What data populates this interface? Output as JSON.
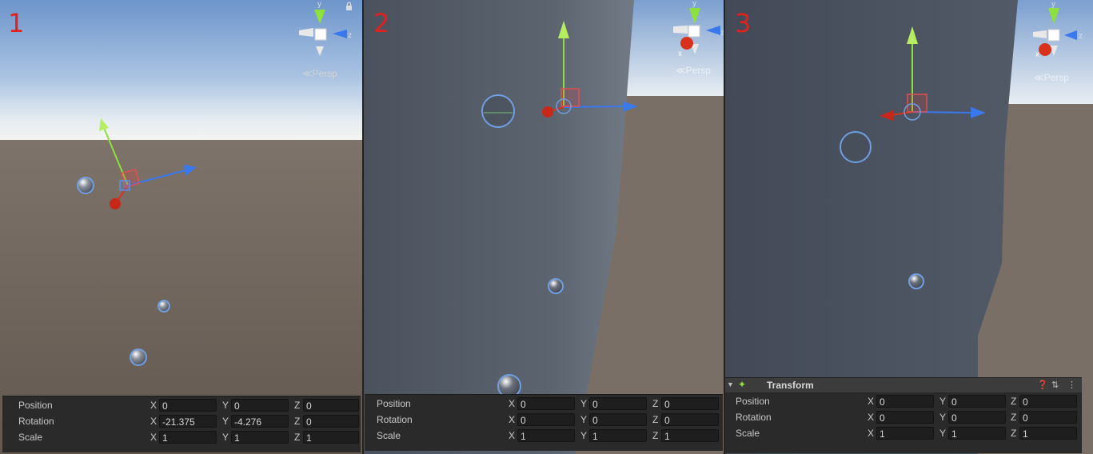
{
  "panels": [
    {
      "number": "1",
      "persp_label": "Persp",
      "gizmo": {
        "y": "y",
        "z": "z",
        "x": ""
      },
      "inspector": {
        "rows": [
          {
            "label": "Position",
            "x": "0",
            "y": "0",
            "z": "0"
          },
          {
            "label": "Rotation",
            "x": "-21.375",
            "y": "-4.276",
            "z": "0"
          },
          {
            "label": "Scale",
            "x": "1",
            "y": "1",
            "z": "1"
          }
        ]
      }
    },
    {
      "number": "2",
      "persp_label": "Persp",
      "gizmo": {
        "y": "y",
        "z": "z",
        "x": "x"
      },
      "inspector": {
        "rows": [
          {
            "label": "Position",
            "x": "0",
            "y": "0",
            "z": "0"
          },
          {
            "label": "Rotation",
            "x": "0",
            "y": "0",
            "z": "0"
          },
          {
            "label": "Scale",
            "x": "1",
            "y": "1",
            "z": "1"
          }
        ]
      }
    },
    {
      "number": "3",
      "persp_label": "Persp",
      "gizmo": {
        "y": "y",
        "z": "z",
        "x": "x"
      },
      "inspector": {
        "header": "Transform",
        "rows": [
          {
            "label": "Position",
            "x": "0",
            "y": "0",
            "z": "0"
          },
          {
            "label": "Rotation",
            "x": "0",
            "y": "0",
            "z": "0"
          },
          {
            "label": "Scale",
            "x": "1",
            "y": "1",
            "z": "1"
          }
        ]
      }
    }
  ],
  "axis_letters": {
    "x": "X",
    "y": "Y",
    "z": "Z"
  },
  "colors": {
    "axis_x": "#d8321e",
    "axis_y": "#8ee03c",
    "axis_z": "#3a78ee",
    "number": "#e0211d",
    "inspector_bg": "#2a2a2a",
    "field_bg": "#1e1e1e"
  }
}
